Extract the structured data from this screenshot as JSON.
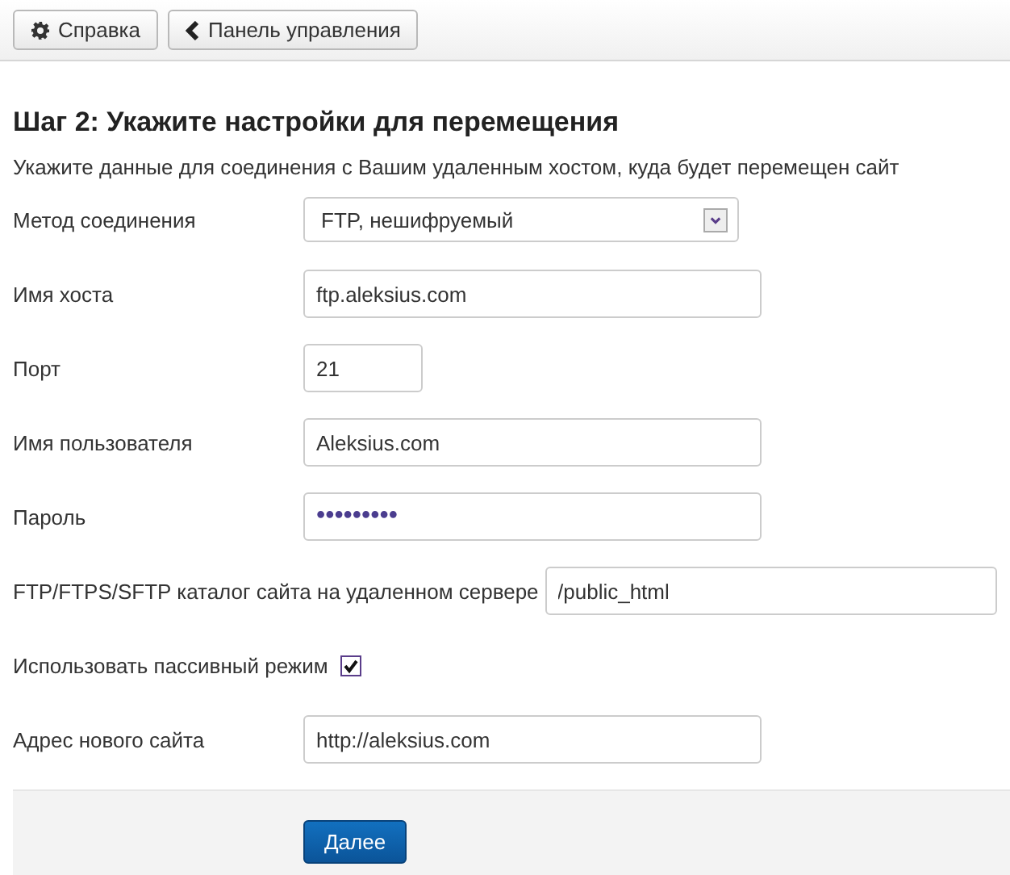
{
  "toolbar": {
    "buttons": [
      {
        "label": "Справка"
      },
      {
        "label": "Панель управления"
      }
    ]
  },
  "heading": "Шаг 2: Укажите настройки для перемещения",
  "description": "Укажите данные для соединения с Вашим удаленным хостом, куда будет перемещен сайт",
  "fields": [
    {
      "kind": "select",
      "label": "Метод соединения",
      "value": "FTP, нешифруемый"
    },
    {
      "kind": "text",
      "label": "Имя хоста",
      "value": "ftp.aleksius.com"
    },
    {
      "kind": "short",
      "label": "Порт",
      "value": "21"
    },
    {
      "kind": "text",
      "label": "Имя пользователя",
      "value": "Aleksius.com"
    },
    {
      "kind": "password",
      "label": "Пароль",
      "value": "•••••••••"
    },
    {
      "kind": "text",
      "label": "FTP/FTPS/SFTP каталог сайта на удаленном сервере",
      "value": "/public_html"
    },
    {
      "kind": "checkbox",
      "label": "Использовать пассивный режим",
      "checked": true
    },
    {
      "kind": "text",
      "label": "Адрес нового сайта",
      "value": "http://aleksius.com"
    }
  ],
  "footer": {
    "button": "Далее"
  }
}
